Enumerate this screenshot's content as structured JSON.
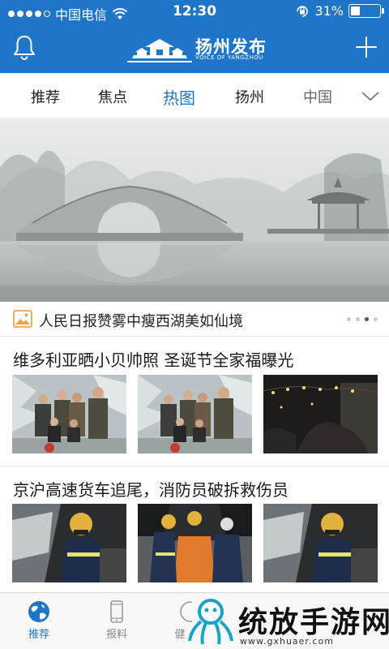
{
  "status_bar": {
    "carrier": "中国电信",
    "time": "12:30",
    "battery_percent": "31%",
    "battery_level": 0.31,
    "icons": [
      "signal-dots",
      "wifi-icon",
      "orientation-lock-icon",
      "battery-icon"
    ]
  },
  "header": {
    "logo_text": "扬州发布",
    "logo_subtitle": "VOICE OF YANGZHOU",
    "left_icon": "bell-icon",
    "right_icon": "plus-icon",
    "color": "#1f76c8"
  },
  "tabs": {
    "items": [
      {
        "label": "推荐"
      },
      {
        "label": "焦点"
      },
      {
        "label": "热图",
        "active": true
      },
      {
        "label": "扬州"
      },
      {
        "label": "中国"
      }
    ],
    "more_icon": "chevron-down-icon"
  },
  "banner": {
    "caption": "人民日报赞雾中瘦西湖美如仙境",
    "caption_icon": "image-icon",
    "pager_count": 4,
    "pager_active": 3
  },
  "news": [
    {
      "title": "维多利亚晒小贝帅照 圣诞节全家福曝光",
      "thumbnails": [
        "family-photo",
        "family-photo",
        "night-photo"
      ]
    },
    {
      "title": "京沪高速货车追尾，消防员破拆救伤员",
      "thumbnails": [
        "firefighter-photo",
        "firefighter-photo",
        "firefighter-photo"
      ]
    }
  ],
  "bottom_nav": {
    "items": [
      {
        "label": "推荐",
        "icon": "globe-icon",
        "active": true
      },
      {
        "label": "报料",
        "icon": "phone-icon"
      },
      {
        "label": "健",
        "icon": "health-icon"
      }
    ]
  },
  "watermark": {
    "title": "统放手游网",
    "url": "www.gxhuaer.com"
  }
}
